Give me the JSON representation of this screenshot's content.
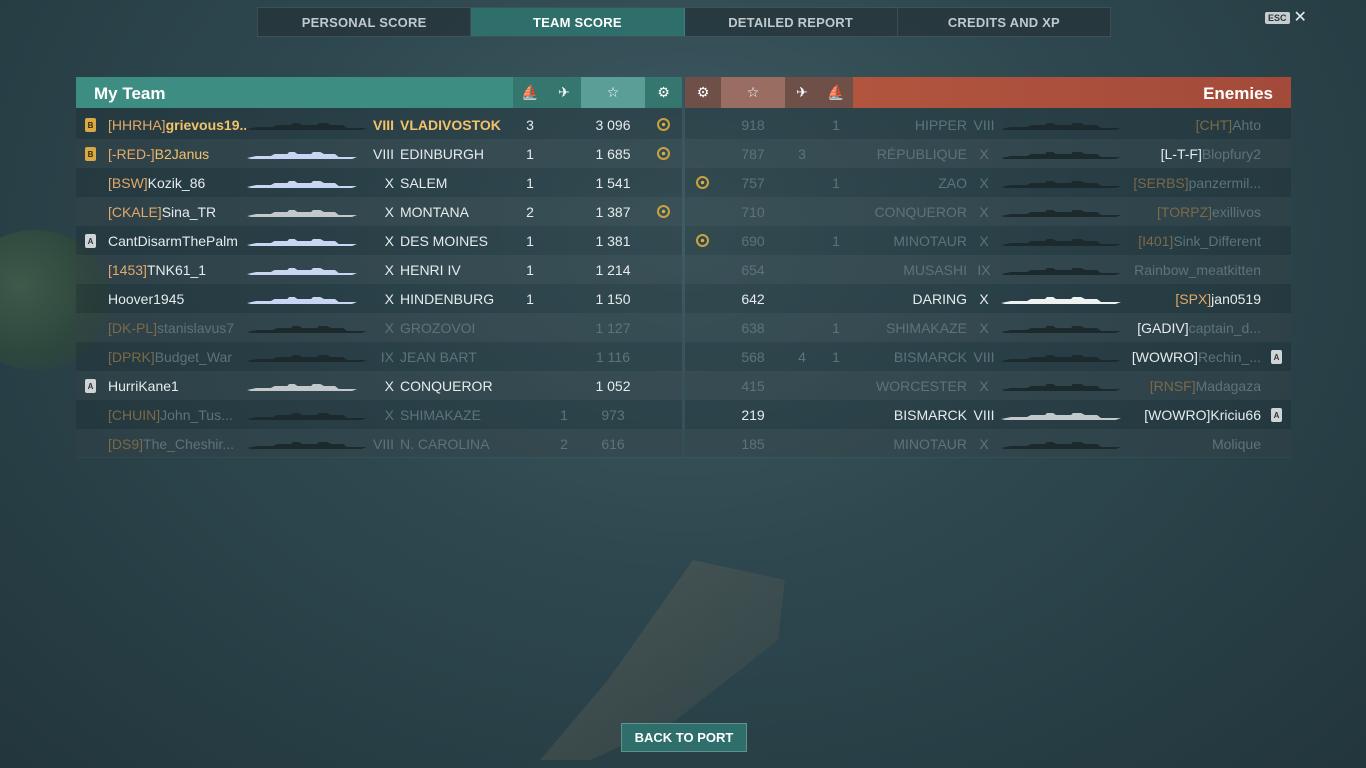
{
  "tabs": [
    "PERSONAL SCORE",
    "TEAM SCORE",
    "DETAILED REPORT",
    "CREDITS AND XP"
  ],
  "active_tab": 1,
  "esc_key": "ESC",
  "close_glyph": "✕",
  "header_icons": {
    "torpedo": "⛵",
    "plane": "✈",
    "star": "☆",
    "emblem": "⚙"
  },
  "my_team": {
    "title": "My Team",
    "color": "#3e8d82",
    "rows": [
      {
        "badge": "B",
        "badge_type": "gold",
        "clan": "[HHRHA]",
        "name": "grievous19...",
        "tier": "VIII",
        "ship": "VLADIVOSTOK",
        "col1": "3",
        "col2": "",
        "score": "3 096",
        "emblem": true,
        "highlight": true,
        "dead": false,
        "ship_color": "dark"
      },
      {
        "badge": "B",
        "badge_type": "gold",
        "clan": "[-RED-]",
        "name": "B2Janus",
        "tier": "VIII",
        "ship": "EDINBURGH",
        "col1": "1",
        "col2": "",
        "score": "1 685",
        "emblem": true,
        "name_gold": true,
        "dead": false,
        "ship_color": "light"
      },
      {
        "badge": "",
        "clan": "[BSW]",
        "name": "Kozik_86",
        "tier": "X",
        "ship": "SALEM",
        "col1": "1",
        "col2": "",
        "score": "1 541",
        "emblem": false,
        "dead": false,
        "ship_color": "light"
      },
      {
        "badge": "",
        "clan": "[CKALE]",
        "name": "Sina_TR",
        "tier": "X",
        "ship": "MONTANA",
        "col1": "2",
        "col2": "",
        "score": "1 387",
        "emblem": true,
        "dead": false,
        "ship_color": "grey"
      },
      {
        "badge": "A",
        "badge_type": "grey",
        "clan": "",
        "name": "CantDisarmThePalm",
        "tier": "X",
        "ship": "DES MOINES",
        "col1": "1",
        "col2": "",
        "score": "1 381",
        "emblem": false,
        "dead": false,
        "ship_color": "light"
      },
      {
        "badge": "",
        "clan": "[1453]",
        "name": "TNK61_1",
        "tier": "X",
        "ship": "HENRI IV",
        "col1": "1",
        "col2": "",
        "score": "1 214",
        "emblem": false,
        "dead": false,
        "ship_color": "light"
      },
      {
        "badge": "",
        "clan": "",
        "name": "Hoover1945",
        "tier": "X",
        "ship": "HINDENBURG",
        "col1": "1",
        "col2": "",
        "score": "1 150",
        "emblem": false,
        "dead": false,
        "ship_color": "light"
      },
      {
        "badge": "",
        "clan": "[DK-PL]",
        "name": "stanislavus7",
        "tier": "X",
        "ship": "GROZOVOI",
        "col1": "",
        "col2": "",
        "score": "1 127",
        "emblem": false,
        "dead": true,
        "ship_color": "dark"
      },
      {
        "badge": "",
        "clan": "[DPRK]",
        "name": "Budget_War",
        "tier": "IX",
        "ship": "JEAN BART",
        "col1": "",
        "col2": "",
        "score": "1 116",
        "emblem": false,
        "dead": true,
        "ship_color": "dark"
      },
      {
        "badge": "A",
        "badge_type": "grey",
        "clan": "",
        "name": "HurriKane1",
        "tier": "X",
        "ship": "CONQUEROR",
        "col1": "",
        "col2": "",
        "score": "1 052",
        "emblem": false,
        "dead": false,
        "ship_color": "grey"
      },
      {
        "badge": "",
        "clan": "[CHUIN]",
        "name": "John_Tus...",
        "tier": "X",
        "ship": "SHIMAKAZE",
        "col1": "",
        "col2": "1",
        "score": "973",
        "emblem": false,
        "dead": true,
        "ship_color": "dark"
      },
      {
        "badge": "",
        "clan": "[DS9]",
        "name": "The_Cheshir...",
        "tier": "VIII",
        "ship": "N. CAROLINA",
        "col1": "",
        "col2": "2",
        "score": "616",
        "emblem": false,
        "dead": true,
        "ship_color": "dark"
      }
    ]
  },
  "enemies": {
    "title": "Enemies",
    "color": "#a84a3a",
    "rows": [
      {
        "score": "918",
        "col2": "",
        "col1": "1",
        "ship": "HIPPER",
        "tier": "VIII",
        "clan": "[CHT]",
        "name": "Ahto",
        "badge": "",
        "emblem": false,
        "dead": true
      },
      {
        "score": "787",
        "col2": "3",
        "col1": "",
        "ship": "RÉPUBLIQUE",
        "tier": "X",
        "clan": "[L-T-F]",
        "name": "Blopfury2",
        "badge": "",
        "emblem": false,
        "dead": true,
        "clan_white": true
      },
      {
        "score": "757",
        "col2": "",
        "col1": "1",
        "ship": "ZAO",
        "tier": "X",
        "clan": "[SERBS]",
        "name": "panzermil...",
        "badge": "",
        "emblem": true,
        "dead": true
      },
      {
        "score": "710",
        "col2": "",
        "col1": "",
        "ship": "CONQUEROR",
        "tier": "X",
        "clan": "[TORPZ]",
        "name": "exillivos",
        "badge": "",
        "emblem": false,
        "dead": true
      },
      {
        "score": "690",
        "col2": "",
        "col1": "1",
        "ship": "MINOTAUR",
        "tier": "X",
        "clan": "[I401]",
        "name": "Sink_Different",
        "badge": "",
        "emblem": true,
        "dead": true
      },
      {
        "score": "654",
        "col2": "",
        "col1": "",
        "ship": "MUSASHI",
        "tier": "IX",
        "clan": "",
        "name": "Rainbow_meatkitten",
        "badge": "",
        "emblem": false,
        "dead": true
      },
      {
        "score": "642",
        "col2": "",
        "col1": "",
        "ship": "DARING",
        "tier": "X",
        "clan": "[SPX]",
        "name": "jan0519",
        "badge": "",
        "emblem": false,
        "dead": false
      },
      {
        "score": "638",
        "col2": "",
        "col1": "1",
        "ship": "SHIMAKAZE",
        "tier": "X",
        "clan": "[GADIV]",
        "name": "captain_d...",
        "badge": "",
        "emblem": false,
        "dead": true,
        "clan_white": true
      },
      {
        "score": "568",
        "col2": "4",
        "col1": "1",
        "ship": "BISMARCK",
        "tier": "VIII",
        "clan": "[WOWRO]",
        "name": "Rechin_...",
        "badge": "A",
        "emblem": false,
        "dead": true,
        "clan_white": true
      },
      {
        "score": "415",
        "col2": "",
        "col1": "",
        "ship": "WORCESTER",
        "tier": "X",
        "clan": "[RNSF]",
        "name": "Madagaza",
        "badge": "",
        "emblem": false,
        "dead": true
      },
      {
        "score": "219",
        "col2": "",
        "col1": "",
        "ship": "BISMARCK",
        "tier": "VIII",
        "clan": "[WOWRO]",
        "name": "Kriciu66",
        "badge": "A",
        "emblem": false,
        "dead": false,
        "clan_white": true
      },
      {
        "score": "185",
        "col2": "",
        "col1": "",
        "ship": "MINOTAUR",
        "tier": "X",
        "clan": "",
        "name": "Molique",
        "badge": "",
        "emblem": false,
        "dead": true
      }
    ]
  },
  "back_button": "BACK TO PORT"
}
